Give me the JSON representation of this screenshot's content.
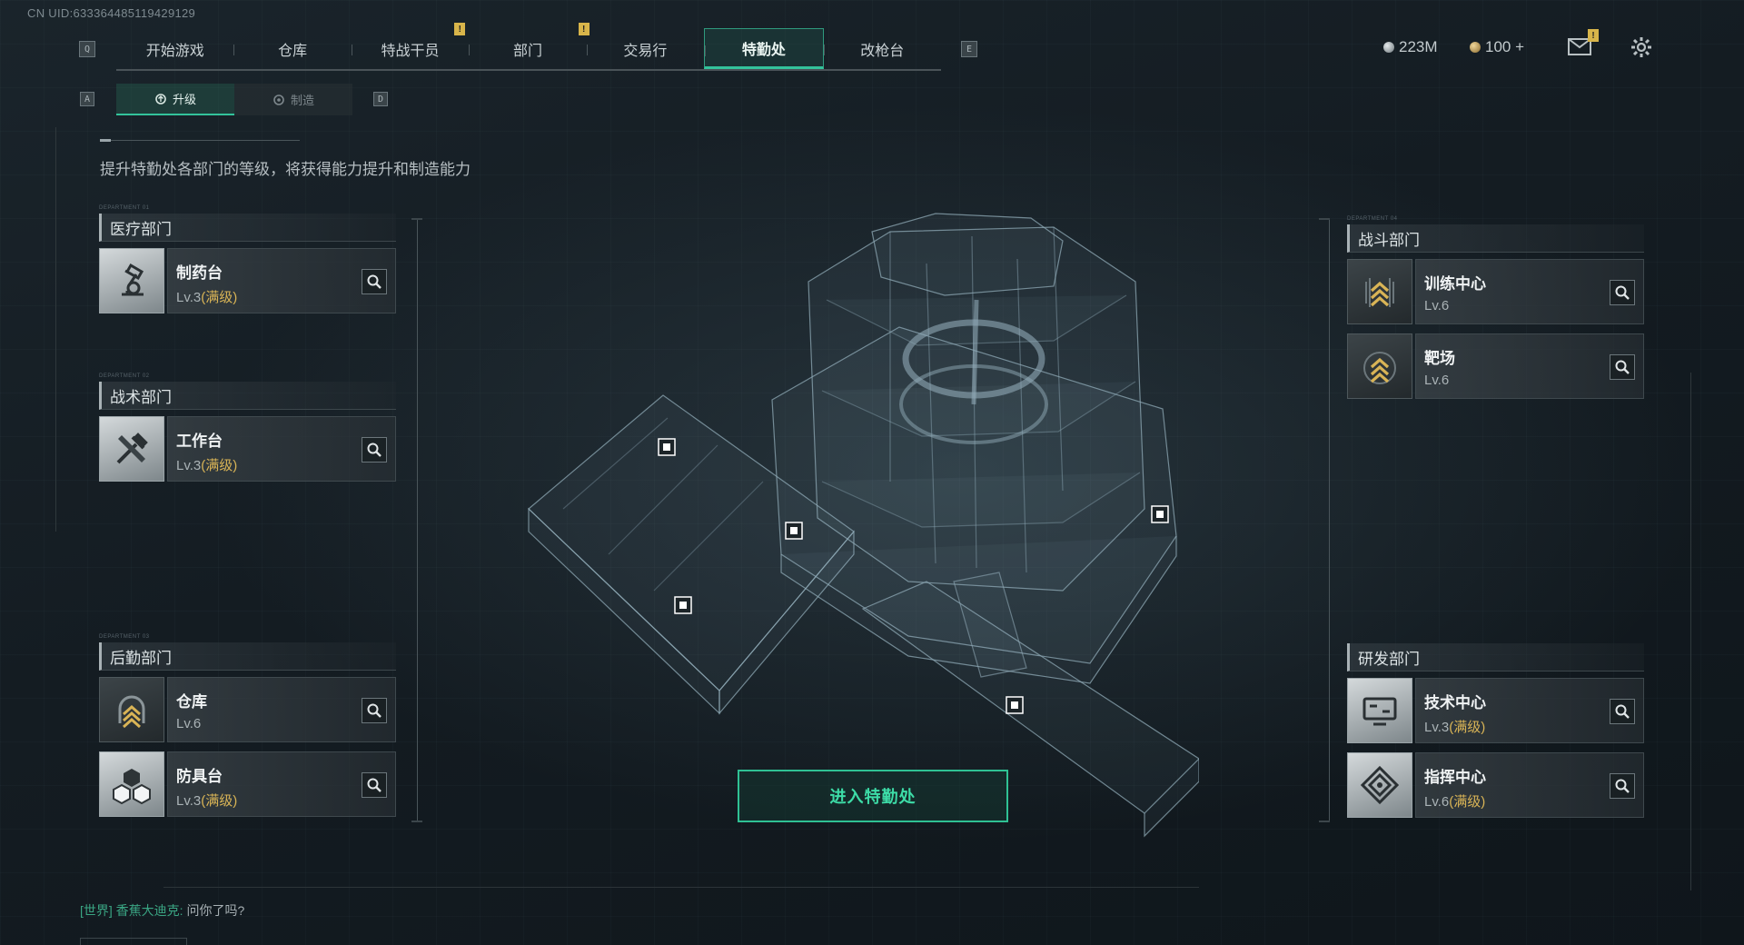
{
  "uid": "CN UID:633364485119429129",
  "nav": {
    "left_key": "Q",
    "right_key": "E",
    "tabs": [
      {
        "label": "开始游戏",
        "active": false,
        "alert": false
      },
      {
        "label": "仓库",
        "active": false,
        "alert": false
      },
      {
        "label": "特战干员",
        "active": false,
        "alert": true
      },
      {
        "label": "部门",
        "active": false,
        "alert": false
      },
      {
        "label": "交易行",
        "active": false,
        "alert": true
      },
      {
        "label": "特勤处",
        "active": true,
        "alert": false
      },
      {
        "label": "改枪台",
        "active": false,
        "alert": false
      }
    ]
  },
  "resources": {
    "currency": "223M",
    "coins": "100 +",
    "alert_mark": "!"
  },
  "subtabs": {
    "left_key": "A",
    "right_key": "D",
    "items": [
      {
        "label": "升级",
        "active": true
      },
      {
        "label": "制造",
        "active": false
      }
    ]
  },
  "description": "提升特勤处各部门的等级，将获得能力提升和制造能力",
  "departments": {
    "medical": {
      "tag": "DEPARTMENT 01",
      "title": "医疗部门",
      "facilities": [
        {
          "name": "制药台",
          "level": "Lv.3",
          "max": "(满级)",
          "icon": "microscope-icon"
        }
      ]
    },
    "tactical": {
      "tag": "DEPARTMENT 02",
      "title": "战术部门",
      "facilities": [
        {
          "name": "工作台",
          "level": "Lv.3",
          "max": "(满级)",
          "icon": "tools-icon"
        }
      ]
    },
    "logistics": {
      "tag": "DEPARTMENT 03",
      "title": "后勤部门",
      "facilities": [
        {
          "name": "仓库",
          "level": "Lv.6",
          "max": "",
          "icon": "rank-chevron-icon"
        },
        {
          "name": "防具台",
          "level": "Lv.3",
          "max": "(满级)",
          "icon": "cubes-icon"
        }
      ]
    },
    "combat": {
      "tag": "DEPARTMENT 04",
      "title": "战斗部门",
      "facilities": [
        {
          "name": "训练中心",
          "level": "Lv.6",
          "max": "",
          "icon": "rank-chevron-icon"
        },
        {
          "name": "靶场",
          "level": "Lv.6",
          "max": "",
          "icon": "target-chevron-icon"
        }
      ]
    },
    "research": {
      "title": "研发部门",
      "facilities": [
        {
          "name": "技术中心",
          "level": "Lv.3",
          "max": "(满级)",
          "icon": "monitor-icon"
        },
        {
          "name": "指挥中心",
          "level": "Lv.6",
          "max": "(满级)",
          "icon": "command-emblem-icon"
        }
      ]
    }
  },
  "enter_button": "进入特勤处",
  "chat": {
    "channel": "[世界]",
    "sender": "香蕉大迪克:",
    "message": "问你了吗?"
  },
  "colors": {
    "accent": "#33c39b",
    "max_level": "#d9b456",
    "alert": "#d8b54a"
  }
}
